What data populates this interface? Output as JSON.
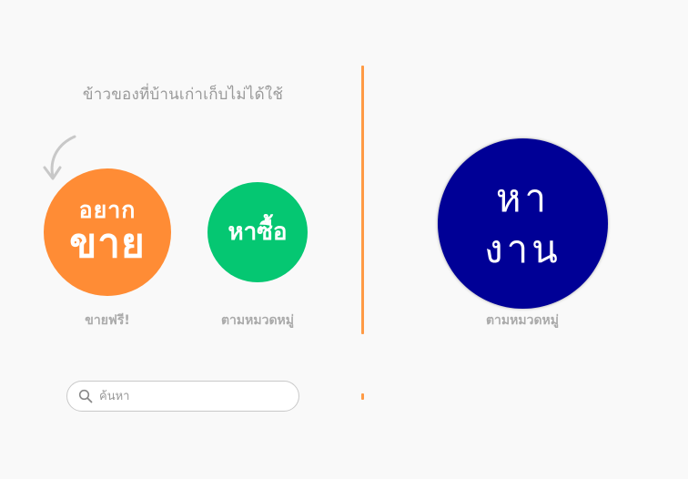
{
  "tagline": "ข้าวของที่บ้านเก่าเก็บไม่ได้ใช้",
  "sell": {
    "small": "อยาก",
    "big": "ขาย",
    "caption": "ขายฟรี!"
  },
  "buy": {
    "label": "หาซื้อ",
    "caption": "ตามหมวดหมู่"
  },
  "job": {
    "line1": "หา",
    "line2": "งาน",
    "caption": "ตามหมวดหมู่"
  },
  "search": {
    "placeholder": "ค้นหา",
    "icon": "search-icon"
  },
  "colors": {
    "sell": "#ff8c35",
    "buy": "#05c772",
    "job": "#000096",
    "divider": "#ff9a45"
  }
}
